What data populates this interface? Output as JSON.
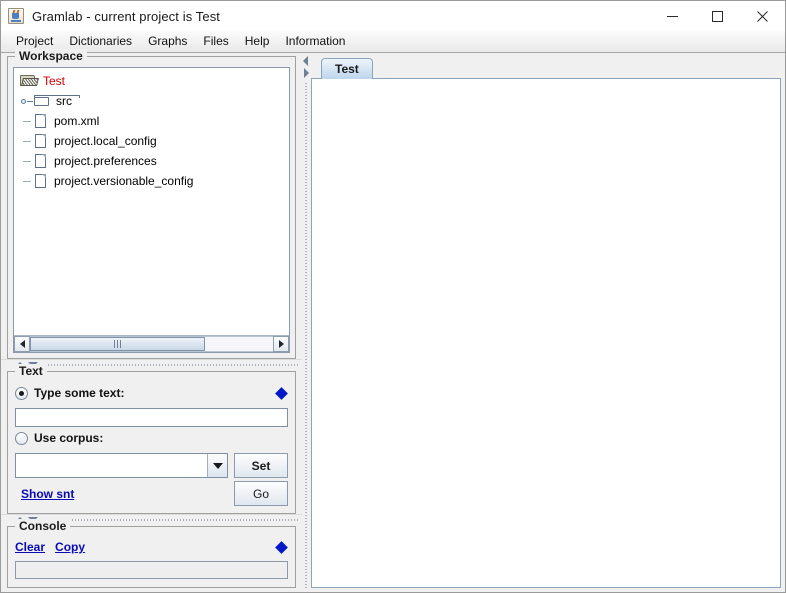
{
  "window": {
    "title": "Gramlab - current project is Test",
    "app_icon": "java-app-icon",
    "minimize_label": "—",
    "maximize_label": "□",
    "close_label": "✕"
  },
  "menubar": {
    "items": [
      {
        "label": "Project"
      },
      {
        "label": "Dictionaries"
      },
      {
        "label": "Graphs"
      },
      {
        "label": "Files"
      },
      {
        "label": "Help"
      },
      {
        "label": "Information"
      }
    ]
  },
  "workspace": {
    "title": "Workspace",
    "tree": [
      {
        "label": "Test",
        "icon": "folder-open-icon",
        "type": "root",
        "expanded": true
      },
      {
        "label": "src",
        "icon": "folder-closed-icon",
        "type": "folder",
        "expanded": false
      },
      {
        "label": "pom.xml",
        "icon": "file-icon",
        "type": "file"
      },
      {
        "label": "project.local_config",
        "icon": "file-icon",
        "type": "file"
      },
      {
        "label": "project.preferences",
        "icon": "file-icon",
        "type": "file"
      },
      {
        "label": "project.versionable_config",
        "icon": "file-icon",
        "type": "file"
      }
    ],
    "scrollbar": {
      "left_arrow": "scroll-left-icon",
      "right_arrow": "scroll-right-icon"
    }
  },
  "text_panel": {
    "title": "Text",
    "type_text_label": "Type some text:",
    "type_text_selected": true,
    "text_input_value": "",
    "use_corpus_label": "Use corpus:",
    "use_corpus_selected": false,
    "corpus_value": "",
    "set_label": "Set",
    "go_label": "Go",
    "show_snt_label": "Show snt"
  },
  "console_panel": {
    "title": "Console",
    "clear_label": "Clear",
    "copy_label": "Copy",
    "console_value": ""
  },
  "editor": {
    "tabs": [
      {
        "label": "Test",
        "selected": true
      }
    ],
    "content": ""
  },
  "colors": {
    "root_node": "#cc0000",
    "link": "#0a0ab4",
    "diamond": "#0018c8",
    "tab_accent": "#bcd6ec",
    "panel_bg": "#f0f0f0"
  }
}
